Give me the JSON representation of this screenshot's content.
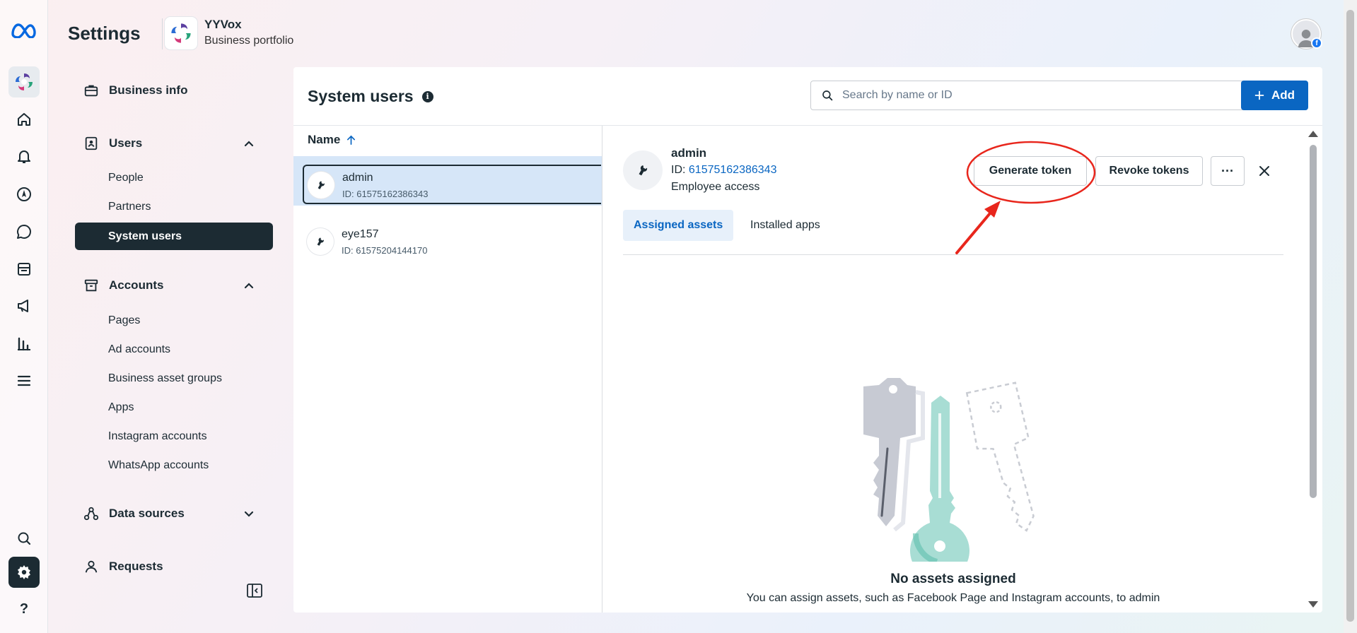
{
  "header": {
    "title": "Settings",
    "portfolio_name": "YYVox",
    "portfolio_subtitle": "Business portfolio"
  },
  "rail": {
    "items": [
      "meta-logo-icon",
      "portfolio-logo-icon",
      "home-icon",
      "bell-icon",
      "compass-icon",
      "chat-icon",
      "pages-icon",
      "megaphone-icon",
      "chart-icon",
      "menu-icon",
      "search-icon",
      "gear-icon",
      "help-icon"
    ],
    "help_label": "?"
  },
  "nav": {
    "business_info": "Business info",
    "users": {
      "label": "Users",
      "items": [
        "People",
        "Partners",
        "System users"
      ]
    },
    "accounts": {
      "label": "Accounts",
      "items": [
        "Pages",
        "Ad accounts",
        "Business asset groups",
        "Apps",
        "Instagram accounts",
        "WhatsApp accounts"
      ]
    },
    "data_sources": "Data sources",
    "requests": "Requests"
  },
  "main": {
    "title": "System users",
    "info_glyph": "i",
    "search_placeholder": "Search by name or ID",
    "add_label": "Add",
    "column_name": "Name",
    "users": [
      {
        "name": "admin",
        "id": "ID: 61575162386343"
      },
      {
        "name": "eye157",
        "id": "ID: 61575204144170"
      }
    ]
  },
  "detail": {
    "name": "admin",
    "id_prefix": "ID: ",
    "id_value": "61575162386343",
    "access": "Employee access",
    "generate_token": "Generate token",
    "revoke_tokens": "Revoke tokens",
    "more_glyph": "···",
    "tabs": [
      "Assigned assets",
      "Installed apps"
    ],
    "empty_title": "No assets assigned",
    "empty_subtitle": "You can assign assets, such as Facebook Page and Instagram accounts, to admin"
  },
  "colors": {
    "brand_blue": "#0a66c2",
    "dark": "#1c2b33",
    "selected_row": "#d6e6f8",
    "annotation_red": "#e8261c"
  }
}
